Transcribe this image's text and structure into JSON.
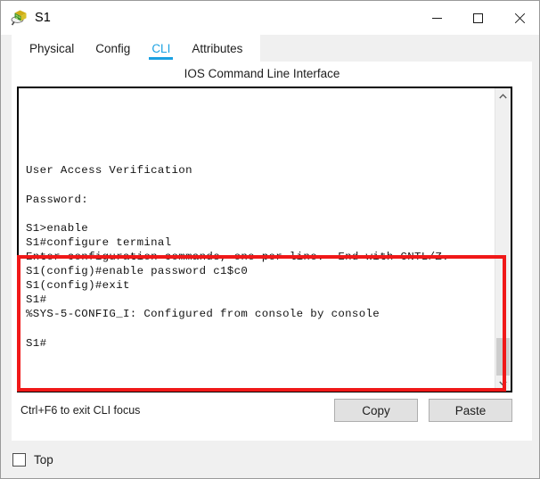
{
  "window": {
    "title": "S1",
    "icon": "packet-tracer-switch-icon",
    "controls": {
      "minimize": "–",
      "maximize": "□",
      "close": "✕"
    }
  },
  "tabs": [
    {
      "label": "Physical",
      "active": false
    },
    {
      "label": "Config",
      "active": false
    },
    {
      "label": "CLI",
      "active": true
    },
    {
      "label": "Attributes",
      "active": false
    }
  ],
  "main": {
    "heading": "IOS Command Line Interface",
    "terminal_text": "\n\n\n\n\nUser Access Verification\n\nPassword:\n\nS1>enable\nS1#configure terminal\nEnter configuration commands, one per line.  End with CNTL/Z.\nS1(config)#enable password c1$c0\nS1(config)#exit\nS1#\n%SYS-5-CONFIG_I: Configured from console by console\n\nS1#",
    "terminal_lines": [
      "",
      "",
      "",
      "",
      "",
      "User Access Verification",
      "",
      "Password:",
      "",
      "S1>enable",
      "S1#configure terminal",
      "Enter configuration commands, one per line.  End with CNTL/Z.",
      "S1(config)#enable password c1$c0",
      "S1(config)#exit",
      "S1#",
      "%SYS-5-CONFIG_I: Configured from console by console",
      "",
      "S1#"
    ],
    "hint": "Ctrl+F6 to exit CLI focus",
    "copy_label": "Copy",
    "paste_label": "Paste"
  },
  "footer": {
    "top_label": "Top",
    "top_checked": false
  },
  "annotation": {
    "highlight_color": "#f01818"
  },
  "colors": {
    "accent": "#1ba1e2",
    "window_bg": "#f0f0f0",
    "panel_bg": "#ffffff",
    "button_bg": "#e1e1e1",
    "scrollbar_thumb": "#cdcdcd"
  }
}
